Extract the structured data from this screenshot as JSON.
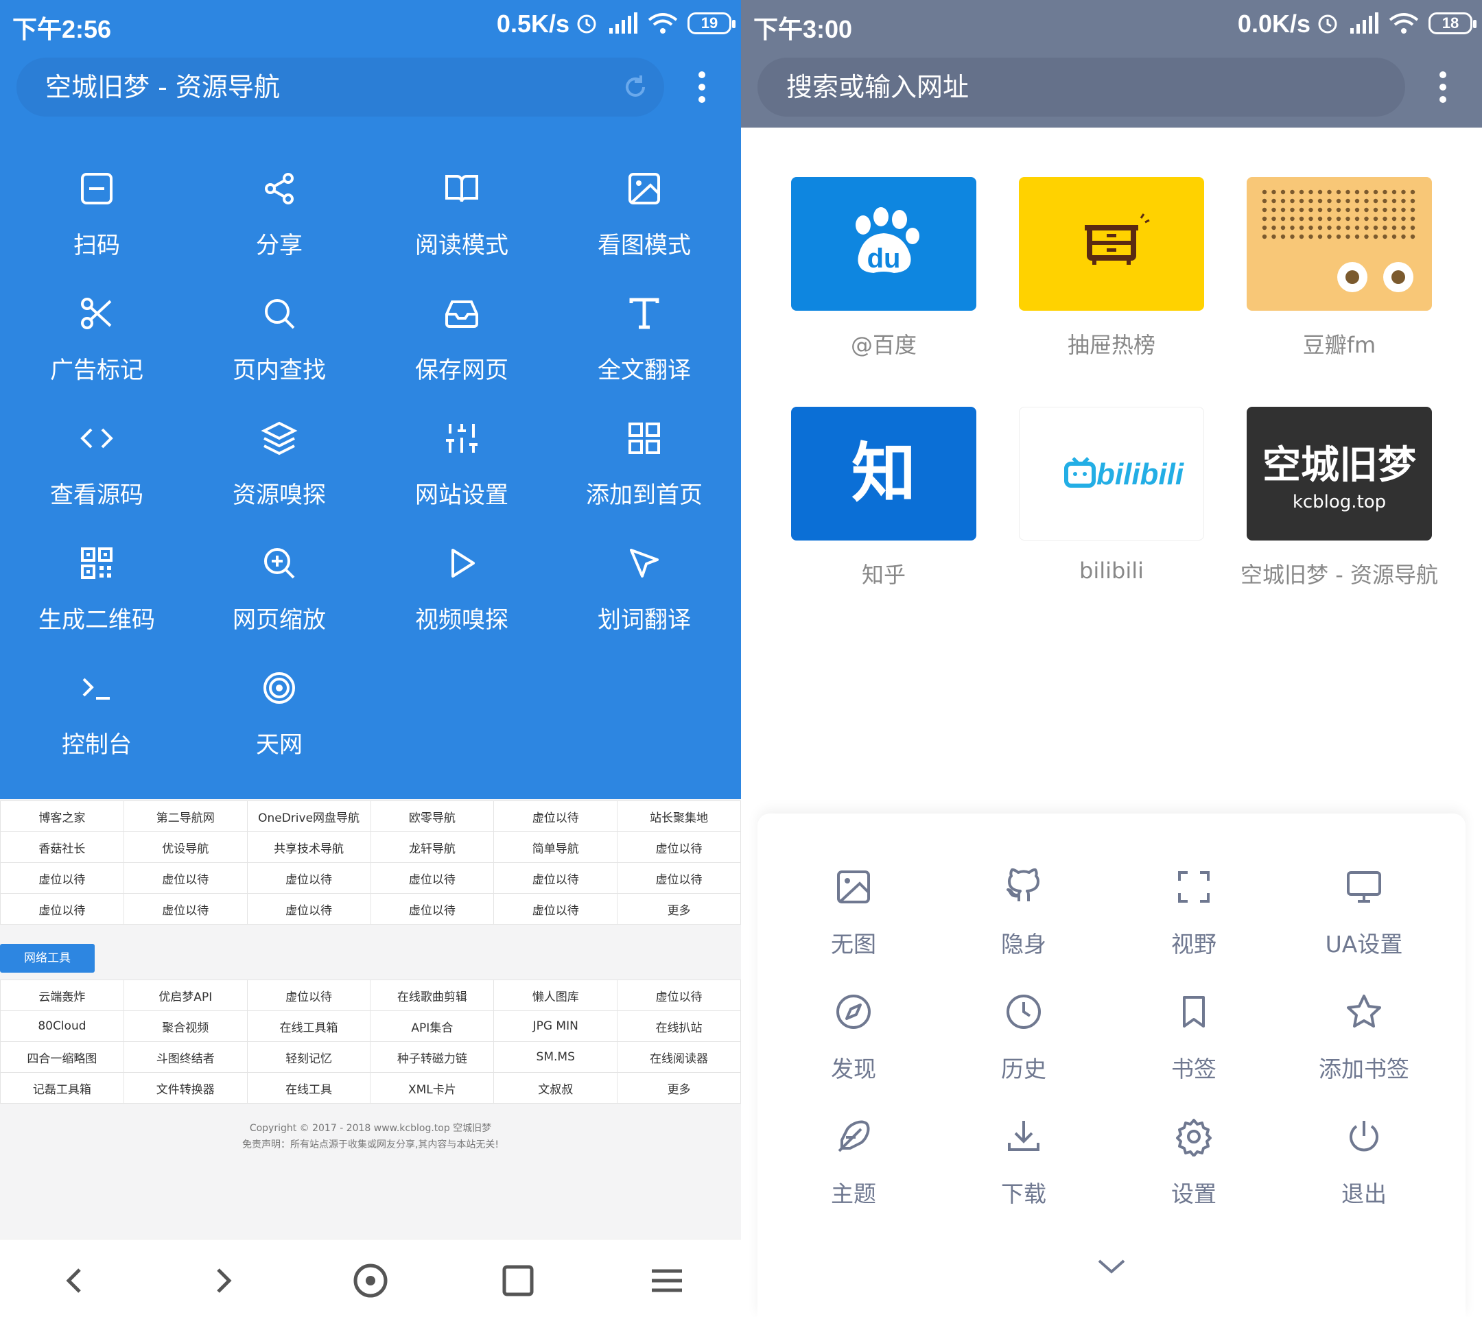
{
  "left": {
    "status": {
      "time": "下午2:56",
      "net": "0.5K/s",
      "battery": "19"
    },
    "address": {
      "title": "空城旧梦 - 资源导航"
    },
    "menu": [
      {
        "label": "扫码",
        "icon": "scan-icon"
      },
      {
        "label": "分享",
        "icon": "share-icon"
      },
      {
        "label": "阅读模式",
        "icon": "book-icon"
      },
      {
        "label": "看图模式",
        "icon": "image-icon"
      },
      {
        "label": "广告标记",
        "icon": "scissors-icon"
      },
      {
        "label": "页内查找",
        "icon": "search-icon"
      },
      {
        "label": "保存网页",
        "icon": "inbox-icon"
      },
      {
        "label": "全文翻译",
        "icon": "text-icon"
      },
      {
        "label": "查看源码",
        "icon": "code-icon"
      },
      {
        "label": "资源嗅探",
        "icon": "layers-icon"
      },
      {
        "label": "网站设置",
        "icon": "sliders-icon"
      },
      {
        "label": "添加到首页",
        "icon": "grid-icon"
      },
      {
        "label": "生成二维码",
        "icon": "qrcode-icon"
      },
      {
        "label": "网页缩放",
        "icon": "zoom-icon"
      },
      {
        "label": "视频嗅探",
        "icon": "play-icon"
      },
      {
        "label": "划词翻译",
        "icon": "pointer-icon"
      },
      {
        "label": "控制台",
        "icon": "terminal-icon"
      },
      {
        "label": "天网",
        "icon": "target-icon"
      }
    ],
    "links1": [
      [
        "博客之家",
        "第二导航网",
        "OneDrive网盘导航",
        "欧零导航",
        "虚位以待",
        "站长聚集地"
      ],
      [
        "香菇社长",
        "优设导航",
        "共享技术导航",
        "龙轩导航",
        "简单导航",
        "虚位以待"
      ],
      [
        "虚位以待",
        "虚位以待",
        "虚位以待",
        "虚位以待",
        "虚位以待",
        "虚位以待"
      ],
      [
        "虚位以待",
        "虚位以待",
        "虚位以待",
        "虚位以待",
        "虚位以待",
        "更多"
      ]
    ],
    "tab_label": "网络工具",
    "links2": [
      [
        "云端轰炸",
        "优启梦API",
        "虚位以待",
        "在线歌曲剪辑",
        "懒人图库",
        "虚位以待"
      ],
      [
        "80Cloud",
        "聚合视频",
        "在线工具箱",
        "API集合",
        "JPG MIN",
        "在线扒站"
      ],
      [
        "四合一缩略图",
        "斗图终结者",
        "轻刻记忆",
        "种子转磁力链",
        "SM.MS",
        "在线阅读器"
      ],
      [
        "记磊工具箱",
        "文件转换器",
        "在线工具",
        "XML卡片",
        "文叔叔",
        "更多"
      ]
    ],
    "footer": {
      "line1": "Copyright © 2017 - 2018  www.kcblog.top 空城旧梦",
      "line2": "免责声明：所有站点源于收集或网友分享,其内容与本站无关!"
    }
  },
  "right": {
    "status": {
      "time": "下午3:00",
      "net": "0.0K/s",
      "battery": "18"
    },
    "address": {
      "placeholder": "搜索或输入网址"
    },
    "tiles": [
      {
        "label": "@百度",
        "text": "du",
        "color": "#0e86e0"
      },
      {
        "label": "抽屉热榜",
        "text": "",
        "color": "#ffd200"
      },
      {
        "label": "豆瓣fm",
        "text": "",
        "color": "#f8c777"
      },
      {
        "label": "知乎",
        "text": "知",
        "color": "#0b6fd6"
      },
      {
        "label": "bilibili",
        "text": "bilibili",
        "color": "#ffffff"
      },
      {
        "label": "空城旧梦 - 资源导航",
        "text": "空城旧梦",
        "subtext": "kcblog.top",
        "color": "#313131"
      }
    ],
    "menu": [
      {
        "label": "无图",
        "icon": "image-icon"
      },
      {
        "label": "隐身",
        "icon": "github-icon"
      },
      {
        "label": "视野",
        "icon": "fullscreen-icon"
      },
      {
        "label": "UA设置",
        "icon": "monitor-icon"
      },
      {
        "label": "发现",
        "icon": "compass-icon"
      },
      {
        "label": "历史",
        "icon": "clock-icon"
      },
      {
        "label": "书签",
        "icon": "bookmark-icon"
      },
      {
        "label": "添加书签",
        "icon": "star-icon"
      },
      {
        "label": "主题",
        "icon": "feather-icon"
      },
      {
        "label": "下载",
        "icon": "download-icon"
      },
      {
        "label": "设置",
        "icon": "settings-icon"
      },
      {
        "label": "退出",
        "icon": "power-icon"
      }
    ]
  },
  "colors": {
    "blue": "#2d86e1",
    "grey_header": "#6e7b94",
    "menu_icon": "#6f7890"
  }
}
